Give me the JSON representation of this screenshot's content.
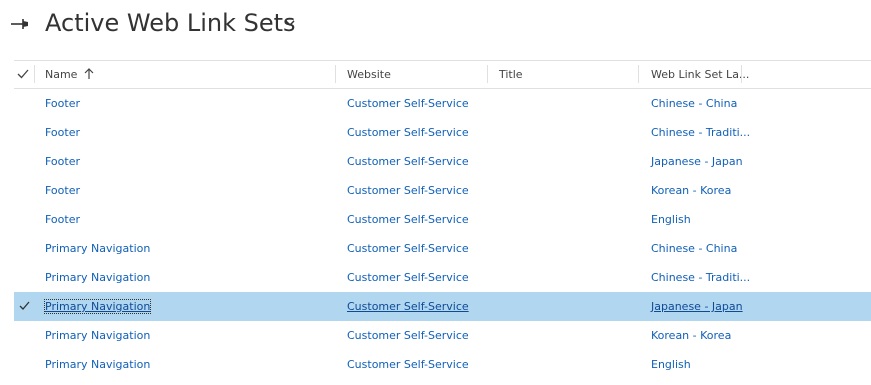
{
  "view": {
    "title": "Active Web Link Sets"
  },
  "grid": {
    "columns": {
      "name": "Name",
      "website": "Website",
      "title": "Title",
      "language": "Web Link Set La..."
    },
    "rows": [
      {
        "name": "Footer",
        "website": "Customer Self-Service",
        "title": "",
        "language": "Chinese - China",
        "selected": false
      },
      {
        "name": "Footer",
        "website": "Customer Self-Service",
        "title": "",
        "language": "Chinese - Traditi...",
        "selected": false
      },
      {
        "name": "Footer",
        "website": "Customer Self-Service",
        "title": "",
        "language": "Japanese - Japan",
        "selected": false
      },
      {
        "name": "Footer",
        "website": "Customer Self-Service",
        "title": "",
        "language": "Korean - Korea",
        "selected": false
      },
      {
        "name": "Footer",
        "website": "Customer Self-Service",
        "title": "",
        "language": "English",
        "selected": false
      },
      {
        "name": "Primary Navigation",
        "website": "Customer Self-Service",
        "title": "",
        "language": "Chinese - China",
        "selected": false
      },
      {
        "name": "Primary Navigation",
        "website": "Customer Self-Service",
        "title": "",
        "language": "Chinese - Traditi...",
        "selected": false
      },
      {
        "name": "Primary Navigation",
        "website": "Customer Self-Service",
        "title": "",
        "language": "Japanese - Japan",
        "selected": true
      },
      {
        "name": "Primary Navigation",
        "website": "Customer Self-Service",
        "title": "",
        "language": "Korean - Korea",
        "selected": false
      },
      {
        "name": "Primary Navigation",
        "website": "Customer Self-Service",
        "title": "",
        "language": "English",
        "selected": false
      }
    ]
  },
  "colors": {
    "link": "#1160b7",
    "selected_row": "#b1d6f0",
    "header_text": "#444444"
  }
}
